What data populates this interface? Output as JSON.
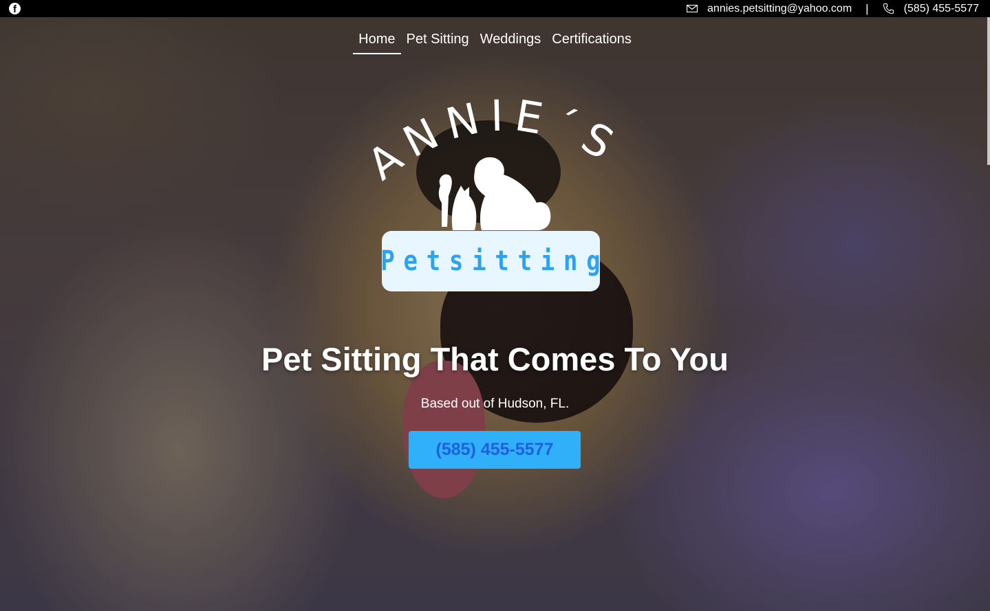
{
  "topbar": {
    "facebook_icon": "facebook-icon",
    "email": "annies.petsitting@yahoo.com",
    "separator": "|",
    "phone": "(585) 455-5577"
  },
  "nav": {
    "items": [
      {
        "label": "Home",
        "active": true
      },
      {
        "label": "Pet Sitting",
        "active": false
      },
      {
        "label": "Weddings",
        "active": false
      },
      {
        "label": "Certifications",
        "active": false
      }
    ]
  },
  "logo": {
    "arc_text": "ANNIE´S",
    "box_text": "Petsitting"
  },
  "hero": {
    "headline": "Pet Sitting That Comes To You",
    "subtext": "Based out of Hudson, FL.",
    "cta_label": "(585) 455-5577"
  },
  "colors": {
    "topbar_bg": "#000000",
    "cta_bg": "#2fb0f8",
    "cta_text": "#1f5fe0",
    "logo_box_bg": "#e8f6ff",
    "logo_text": "#2ea2f0"
  }
}
